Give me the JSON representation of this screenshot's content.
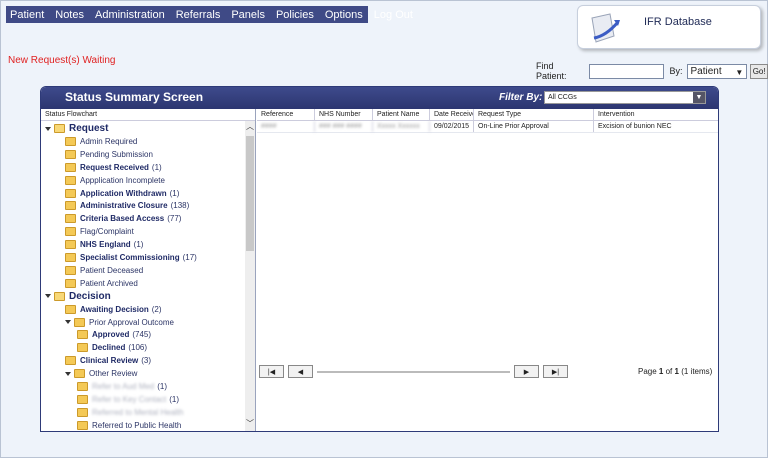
{
  "menu": [
    "Patient",
    "Notes",
    "Administration",
    "Referrals",
    "Panels",
    "Policies",
    "Options",
    "Log Out"
  ],
  "logo": {
    "title": "IFR Database"
  },
  "alert": "New Request(s) Waiting",
  "find": {
    "label": "Find Patient:",
    "value": "",
    "by_label": "By:",
    "by_value": "Patient",
    "go_label": "Go!"
  },
  "panel": {
    "title": "Status Summary Screen",
    "filter_label": "Filter By:",
    "filter_value": "All CCGs"
  },
  "tree": {
    "header": "Status Flowchart",
    "nodes": [
      {
        "label": "Request",
        "count": "",
        "level": 0,
        "bold": true
      },
      {
        "label": "Admin Required",
        "count": "",
        "level": 1,
        "bold": false
      },
      {
        "label": "Pending Submission",
        "count": "",
        "level": 1,
        "bold": false
      },
      {
        "label": "Request Received",
        "count": "(1)",
        "level": 1,
        "bold": true
      },
      {
        "label": "Appplication Incomplete",
        "count": "",
        "level": 1,
        "bold": false
      },
      {
        "label": "Application Withdrawn",
        "count": "(1)",
        "level": 1,
        "bold": true
      },
      {
        "label": "Administrative Closure",
        "count": "(138)",
        "level": 1,
        "bold": true
      },
      {
        "label": "Criteria Based Access",
        "count": "(77)",
        "level": 1,
        "bold": true
      },
      {
        "label": "Flag/Complaint",
        "count": "",
        "level": 1,
        "bold": false
      },
      {
        "label": "NHS England",
        "count": "(1)",
        "level": 1,
        "bold": true
      },
      {
        "label": "Specialist Commissioning",
        "count": "(17)",
        "level": 1,
        "bold": true
      },
      {
        "label": "Patient Deceased",
        "count": "",
        "level": 1,
        "bold": false
      },
      {
        "label": "Patient Archived",
        "count": "",
        "level": 1,
        "bold": false
      },
      {
        "label": "Decision",
        "count": "",
        "level": 0,
        "bold": true
      },
      {
        "label": "Awaiting Decision",
        "count": "(2)",
        "level": 1,
        "bold": true
      },
      {
        "label": "Prior Approval Outcome",
        "count": "",
        "level": 1,
        "bold": false
      },
      {
        "label": "Approved",
        "count": "(745)",
        "level": 2,
        "bold": true
      },
      {
        "label": "Declined",
        "count": "(106)",
        "level": 2,
        "bold": true
      },
      {
        "label": "Clinical Review",
        "count": "(3)",
        "level": 1,
        "bold": true
      },
      {
        "label": "Other Review",
        "count": "",
        "level": 1,
        "bold": false
      },
      {
        "label": "Refer to Aud Med",
        "count": "(1)",
        "level": 2,
        "bold": false,
        "blur": true
      },
      {
        "label": "Refer to Key Contact",
        "count": "(1)",
        "level": 2,
        "bold": false,
        "blur": true
      },
      {
        "label": "Referred to Mental Health",
        "count": "",
        "level": 2,
        "bold": false,
        "blur": true
      },
      {
        "label": "Referred to Public Health",
        "count": "",
        "level": 2,
        "bold": false
      }
    ]
  },
  "grid": {
    "columns": [
      "Reference",
      "NHS Number",
      "Patient Name",
      "Date Receive",
      "Request Type",
      "Intervention"
    ],
    "rows": [
      [
        "####",
        "### ### ####",
        "Xxxxx Xxxxxx",
        "09/02/2015",
        "On-Line Prior Approval",
        "Excision of bunion NEC"
      ]
    ]
  },
  "pager": {
    "first": "|◀",
    "prev": "◀",
    "next": "▶",
    "last": "▶|",
    "page_word": "Page",
    "page": "1",
    "of_word": "of",
    "total": "1",
    "items": "(1 items)"
  }
}
